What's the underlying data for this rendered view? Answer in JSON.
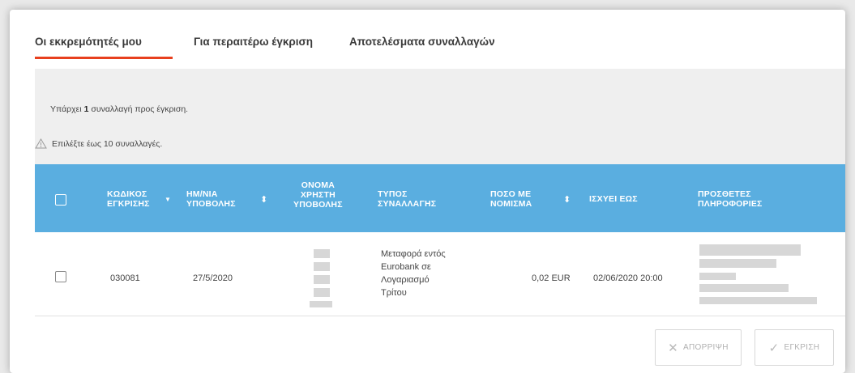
{
  "tabs": [
    {
      "label": "Οι εκκρεμότητές μου",
      "active": true
    },
    {
      "label": "Για περαιτέρω έγκριση",
      "active": false
    },
    {
      "label": "Αποτελέσματα συναλλαγών",
      "active": false
    }
  ],
  "info": {
    "prefix": "Υπάρχει",
    "count": "1",
    "suffix": "συναλλαγή προς έγκριση.",
    "warning": "Επιλέξτε έως 10 συναλλαγές."
  },
  "table": {
    "headers": [
      {
        "lines": [
          "ΚΩΔΙΚΟΣ",
          "ΕΓΚΡΙΣΗΣ"
        ],
        "sort": "▼"
      },
      {
        "lines": [
          "ΗΜ/ΝΙΑ",
          "ΥΠΟΒΟΛΗΣ"
        ],
        "sort": "⬍"
      },
      {
        "lines": [
          "ΟΝΟΜΑ",
          "ΧΡΗΣΤΗ",
          "ΥΠΟΒΟΛΗΣ"
        ],
        "sort": ""
      },
      {
        "lines": [
          "ΤΥΠΟΣ",
          "ΣΥΝΑΛΛΑΓΗΣ"
        ],
        "sort": ""
      },
      {
        "lines": [
          "ΠΟΣΟ ΜΕ",
          "ΝΟΜΙΣΜΑ"
        ],
        "sort": "⬍"
      },
      {
        "lines": [
          "ΙΣΧΥΕΙ ΕΩΣ"
        ],
        "sort": ""
      },
      {
        "lines": [
          "ΠΡΟΣΘΕΤΕΣ",
          "ΠΛΗΡΟΦΟΡΙΕΣ"
        ],
        "sort": ""
      }
    ],
    "rows": [
      {
        "code": "030081",
        "date": "27/5/2020",
        "type_lines": [
          "Μεταφορά εντός",
          "Eurobank σε",
          "Λογαριασμό",
          "Τρίτου"
        ],
        "amount": "0,02 EUR",
        "valid_until": "02/06/2020 20:00"
      }
    ]
  },
  "buttons": {
    "reject": "ΑΠΟΡΡΙΨΗ",
    "approve": "ΕΓΚΡΙΣΗ"
  },
  "colors": {
    "accent": "#e8401e",
    "header_bg": "#5aaee0"
  }
}
